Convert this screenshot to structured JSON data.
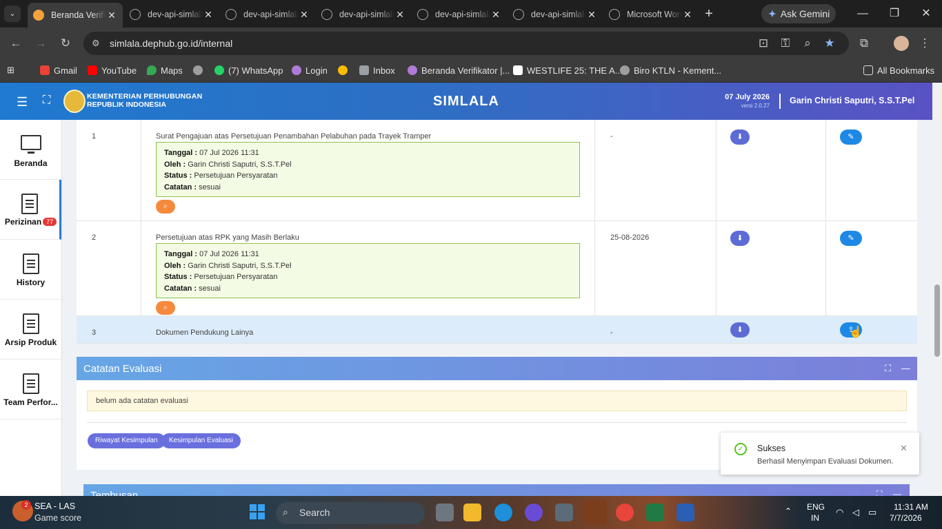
{
  "browser": {
    "tabs": [
      {
        "label": "Beranda Verifikator",
        "active": true
      },
      {
        "label": "dev-api-simlala",
        "active": false
      },
      {
        "label": "dev-api-simlala",
        "active": false
      },
      {
        "label": "dev-api-simlala",
        "active": false
      },
      {
        "label": "dev-api-simlala",
        "active": false
      },
      {
        "label": "dev-api-simlala",
        "active": false
      },
      {
        "label": "Microsoft Word",
        "active": false
      }
    ],
    "ask_gemini": "Ask Gemini",
    "url": "simlala.dephub.go.id/internal",
    "bookmarks": [
      {
        "label": "Gmail",
        "color": "#ea4335"
      },
      {
        "label": "YouTube",
        "color": "#ff0000"
      },
      {
        "label": "Maps",
        "color": "#34a853"
      },
      {
        "label": "",
        "color": "#9e9e9e"
      },
      {
        "label": "(7) WhatsApp",
        "color": "#25d366"
      },
      {
        "label": "Login",
        "color": "#b07bd8"
      },
      {
        "label": "",
        "color": "#fbbc04"
      },
      {
        "label": "Inbox",
        "color": "#9aa0a6"
      },
      {
        "label": "Beranda Verifikator |...",
        "color": "#b07bd8"
      },
      {
        "label": "WESTLIFE 25: THE A...",
        "color": "#ffffff"
      },
      {
        "label": "Biro KTLN - Kement...",
        "color": "#9e9e9e"
      }
    ],
    "all_bookmarks": "All Bookmarks"
  },
  "header": {
    "org_line1": "KEMENTERIAN PERHUBUNGAN",
    "org_line2": "REPUBLIK INDONESIA",
    "app_title": "SIMLALA",
    "date": "07 July 2026",
    "version": "versi 2.0.27",
    "user": "Garin Christi Saputri, S.S.T.Pel"
  },
  "sidebar": [
    {
      "label": "Beranda",
      "icon": "monitor-icon"
    },
    {
      "label": "Perizinan",
      "icon": "document-icon",
      "badge": "77"
    },
    {
      "label": "History",
      "icon": "document-icon"
    },
    {
      "label": "Arsip Produk",
      "icon": "document-icon"
    },
    {
      "label": "Team Perfor...",
      "icon": "document-icon"
    }
  ],
  "documents": {
    "rows": [
      {
        "no": "1",
        "name": "Surat Pengajuan atas Persetujuan Penambahan Pelabuhan pada Trayek Tramper",
        "tanggal_label": "Tanggal :",
        "tanggal": "07 Jul 2026 11:31",
        "oleh_label": "Oleh :",
        "oleh": "Garin Christi Saputri, S.S.T.Pel",
        "status_label": "Status :",
        "status": "Persetujuan Persyaratan",
        "catatan_label": "Catatan :",
        "catatan": "sesuai",
        "date": "-"
      },
      {
        "no": "2",
        "name": "Persetujuan atas RPK yang Masih Berlaku",
        "tanggal_label": "Tanggal :",
        "tanggal": "07 Jul 2026 11:31",
        "oleh_label": "Oleh :",
        "oleh": "Garin Christi Saputri, S.S.T.Pel",
        "status_label": "Status :",
        "status": "Persetujuan Persyaratan",
        "catatan_label": "Catatan :",
        "catatan": "sesuai",
        "date": "25-08-2026"
      },
      {
        "no": "3",
        "name": "Dokumen Pendukung Lainya",
        "date": "-"
      }
    ]
  },
  "evaluasi": {
    "title": "Catatan Evaluasi",
    "note": "belum ada catatan evaluasi",
    "btn_riwayat": "Riwayat Kesimpulan",
    "btn_kesimpulan": "Kesimpulan Evaluasi"
  },
  "tembusan": {
    "title": "Tembusan"
  },
  "toast": {
    "title": "Sukses",
    "message": "Berhasil Menyimpan Evaluasi Dokumen."
  },
  "taskbar": {
    "weather_badge": "2",
    "weather_line1": "SEA - LAS",
    "weather_line2": "Game score",
    "search": "Search",
    "lang1": "ENG",
    "lang2": "IN",
    "time": "11:31 AM",
    "date": "7/7/2026"
  }
}
